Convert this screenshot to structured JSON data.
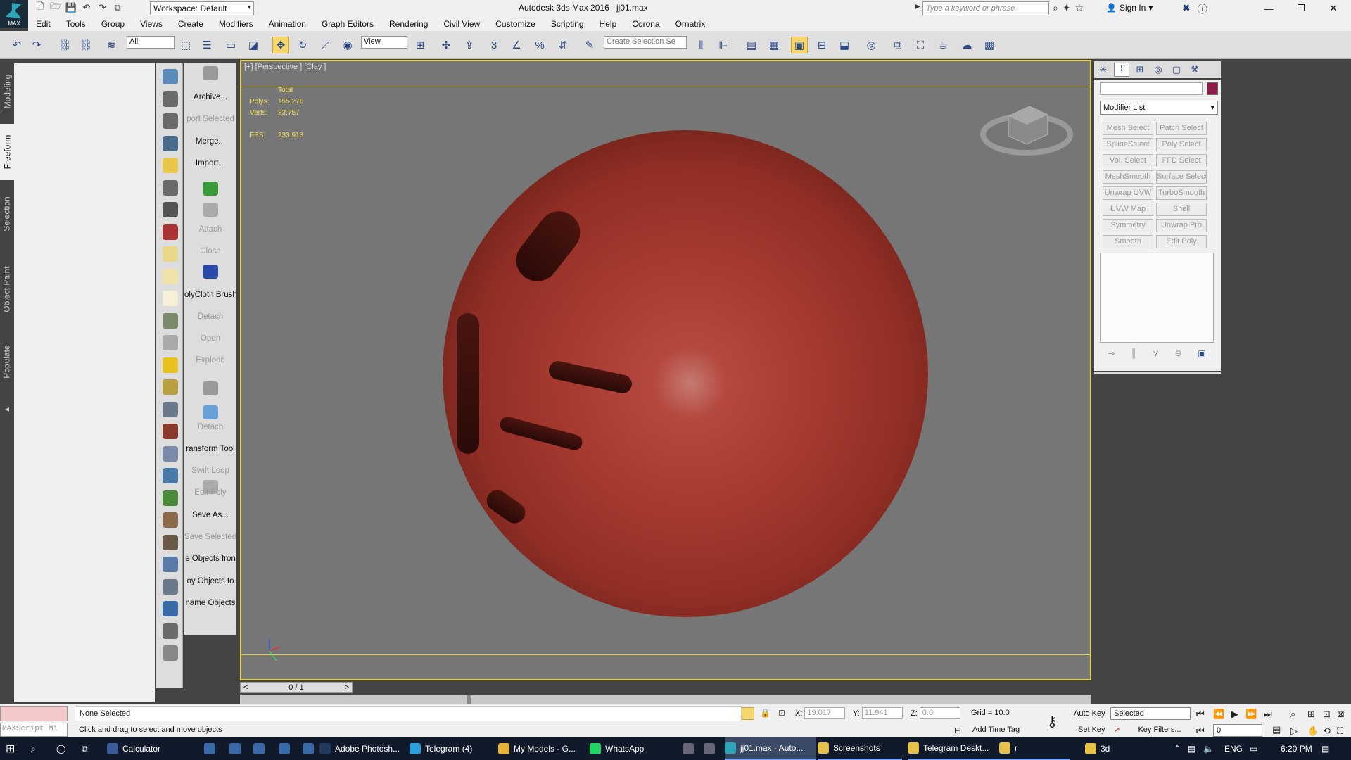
{
  "app": {
    "logo_label": "MAX",
    "title": "Autodesk 3ds Max 2016",
    "file_name": "jj01.max",
    "workspace": "Workspace: Default",
    "search_placeholder": "Type a keyword or phrase",
    "sign_in": "Sign In"
  },
  "menu": [
    "Edit",
    "Tools",
    "Group",
    "Views",
    "Create",
    "Modifiers",
    "Animation",
    "Graph Editors",
    "Rendering",
    "Civil View",
    "Customize",
    "Scripting",
    "Help",
    "Corona",
    "Ornatrix"
  ],
  "toolbar": {
    "selection_filter": "All",
    "ref_coord": "View",
    "create_selection_set": "Create Selection Se"
  },
  "ribbon_tabs": [
    "Modeling",
    "Freeform",
    "Selection",
    "Object Paint",
    "Populate"
  ],
  "script_panel": {
    "items": [
      {
        "label": "Archive...",
        "dim": false
      },
      {
        "label": "port Selected",
        "dim": true
      },
      {
        "label": "Merge...",
        "dim": false
      },
      {
        "label": "Import...",
        "dim": false
      },
      {
        "label": "Attach",
        "dim": true
      },
      {
        "label": "Close",
        "dim": true
      },
      {
        "label": "olyCloth Brush",
        "dim": false
      },
      {
        "label": "Detach",
        "dim": true
      },
      {
        "label": "Open",
        "dim": true
      },
      {
        "label": "Explode",
        "dim": true
      },
      {
        "label": "Detach",
        "dim": true
      },
      {
        "label": "ransform Tool",
        "dim": false
      },
      {
        "label": "Swift Loop",
        "dim": true
      },
      {
        "label": "Edit Poly",
        "dim": true
      },
      {
        "label": "Save As...",
        "dim": false
      },
      {
        "label": "Save Selected",
        "dim": true
      },
      {
        "label": "e Objects fron",
        "dim": false
      },
      {
        "label": "oy Objects to",
        "dim": false
      },
      {
        "label": "name Objects",
        "dim": false
      }
    ]
  },
  "viewport": {
    "label": "[+] [Perspective ] [Clay ]",
    "stats": {
      "total_label": "Total",
      "polys_label": "Polys:",
      "polys": "155,276",
      "verts_label": "Verts:",
      "verts": "83,757",
      "fps_label": "FPS:",
      "fps": "233.913"
    },
    "object_color": "#a73a30"
  },
  "timeline": {
    "position": "0 / 1",
    "prev": "<",
    "next": ">"
  },
  "command_panel": {
    "modifier_list": "Modifier List",
    "swatch_color": "#8b1b47",
    "modifier_buttons": [
      [
        "Mesh Select",
        "Patch Select"
      ],
      [
        "SplineSelect",
        "Poly Select"
      ],
      [
        "Vol. Select",
        "FFD Select"
      ],
      [
        "MeshSmooth",
        "Surface Select"
      ],
      [
        "Unwrap UVW",
        "TurboSmooth"
      ],
      [
        "UVW Map",
        "Shell"
      ],
      [
        "Symmetry",
        "Unwrap Pro"
      ],
      [
        "Smooth",
        "Edit Poly"
      ]
    ]
  },
  "status": {
    "maxscript": "MAXScript Mi",
    "selection": "None Selected",
    "prompt": "Click and drag to select and move objects",
    "x_label": "X:",
    "x_value": "19.017",
    "y_label": "Y:",
    "y_value": "11.941",
    "z_label": "Z:",
    "z_value": "0.0",
    "grid": "Grid = 10.0",
    "add_time_tag": "Add Time Tag",
    "auto_key": "Auto Key",
    "set_key": "Set Key",
    "selected_dd": "Selected",
    "key_filters": "Key Filters...",
    "frame": "0"
  },
  "taskbar": {
    "apps": [
      {
        "label": "Calculator",
        "color": "#3b5b9a"
      },
      {
        "label": "Adobe Photosh...",
        "color": "#1f3a5e"
      },
      {
        "label": "Telegram (4)",
        "color": "#2aa1da"
      },
      {
        "label": "My Models - G...",
        "color": "#e6b23a"
      },
      {
        "label": "WhatsApp",
        "color": "#25d366"
      },
      {
        "label": "jj01.max - Auto...",
        "color": "#2aa6b8"
      },
      {
        "label": "Screenshots",
        "color": "#e7c14a"
      },
      {
        "label": "Telegram Deskt...",
        "color": "#e7c14a"
      },
      {
        "label": "r",
        "color": "#e7c14a"
      },
      {
        "label": "3d",
        "color": "#e7c14a"
      }
    ],
    "language": "ENG",
    "time": "6:20 PM"
  }
}
